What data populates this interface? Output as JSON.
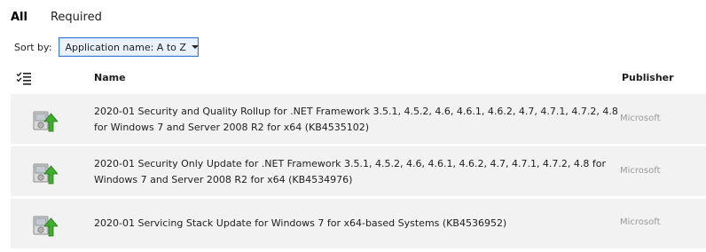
{
  "tabs": [
    {
      "label": "All",
      "active": true
    },
    {
      "label": "Required",
      "active": false
    }
  ],
  "sort": {
    "label": "Sort by:",
    "selected": "Application name: A to Z"
  },
  "columns": {
    "name": "Name",
    "publisher": "Publisher"
  },
  "updates": [
    {
      "name": "2020-01 Security and Quality Rollup for .NET Framework 3.5.1, 4.5.2, 4.6, 4.6.1, 4.6.2, 4.7, 4.7.1, 4.7.2, 4.8 for Windows 7 and Server 2008 R2 for x64 (KB4535102)",
      "publisher": "Microsoft",
      "icon": "software-install-icon"
    },
    {
      "name": "2020-01 Security Only Update for .NET Framework 3.5.1, 4.5.2, 4.6, 4.6.1, 4.6.2, 4.7, 4.7.1, 4.7.2, 4.8 for Windows 7 and Server 2008 R2 for x64 (KB4534976)",
      "publisher": "Microsoft",
      "icon": "software-install-icon"
    },
    {
      "name": "2020-01 Servicing Stack Update for Windows 7 for x64-based Systems (KB4536952)",
      "publisher": "Microsoft",
      "icon": "software-install-icon"
    }
  ],
  "colors": {
    "row_background": "#f2f2f2",
    "select_border": "#3b7bd4",
    "select_background": "#e9f1fb",
    "publisher_text": "#9a9a9a",
    "install_arrow": "#3fae2a"
  }
}
